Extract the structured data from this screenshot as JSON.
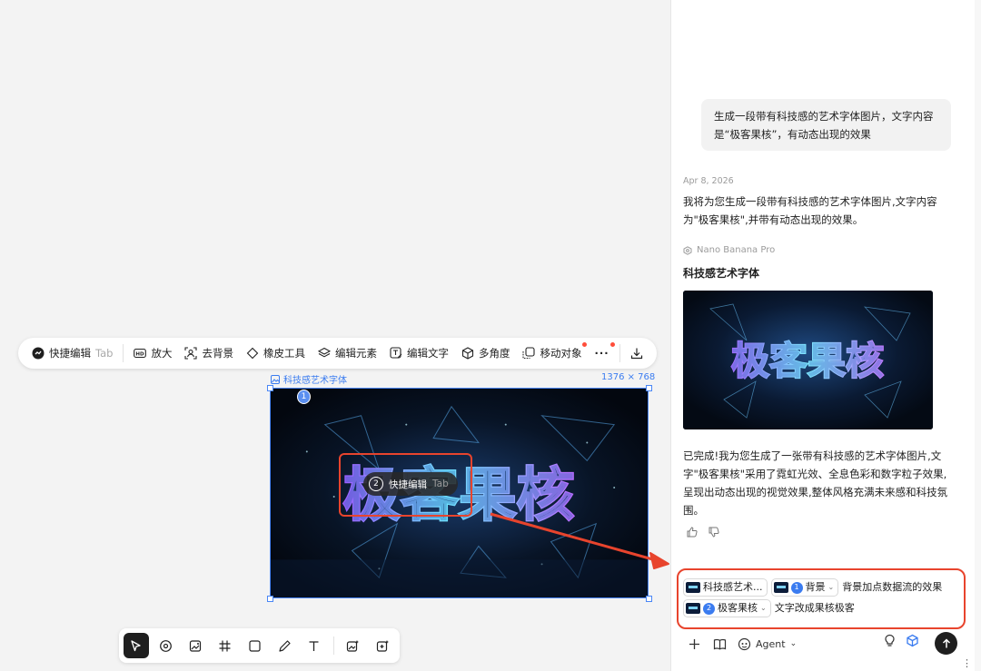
{
  "toolbar": {
    "quick_edit": "快捷编辑",
    "quick_edit_hint": "Tab",
    "upscale": "放大",
    "remove_bg": "去背景",
    "eraser": "橡皮工具",
    "edit_elements": "编辑元素",
    "edit_text": "编辑文字",
    "multi_angle": "多角度",
    "move_object": "移动对象",
    "more": "···"
  },
  "image": {
    "label": "科技感艺术字体",
    "size": "1376 × 768",
    "artwork_text": "极客果核",
    "pin1": "1",
    "pin2": "2"
  },
  "quick_edit_tooltip": {
    "num": "2",
    "label": "快捷编辑",
    "hint": "Tab"
  },
  "chat": {
    "user_message": "生成一段带有科技感的艺术字体图片，文字内容是“极客果核”，有动态出现的效果",
    "date": "Apr 8, 2026",
    "reply": "我将为您生成一段带有科技感的艺术字体图片,文字内容为\"极客果核\",并带有动态出现的效果。",
    "model": "Nano Banana Pro",
    "result_title": "科技感艺术字体",
    "done_text": "已完成!我为您生成了一张带有科技感的艺术字体图片,文字\"极客果核\"采用了霓虹光效、全息色彩和数字粒子效果,呈现出动态出现的视觉效果,整体风格充满未来感和科技氛围。"
  },
  "composer": {
    "chip1": "科技感艺术...",
    "chip2_num": "1",
    "chip2": "背景",
    "text1": "背景加点数据流的效果",
    "chip3_num": "2",
    "chip3": "极客果核",
    "text2": "文字改成果核极客",
    "agent": "Agent"
  },
  "colors": {
    "accent": "#3b7cf0",
    "highlight": "#e8442d"
  }
}
